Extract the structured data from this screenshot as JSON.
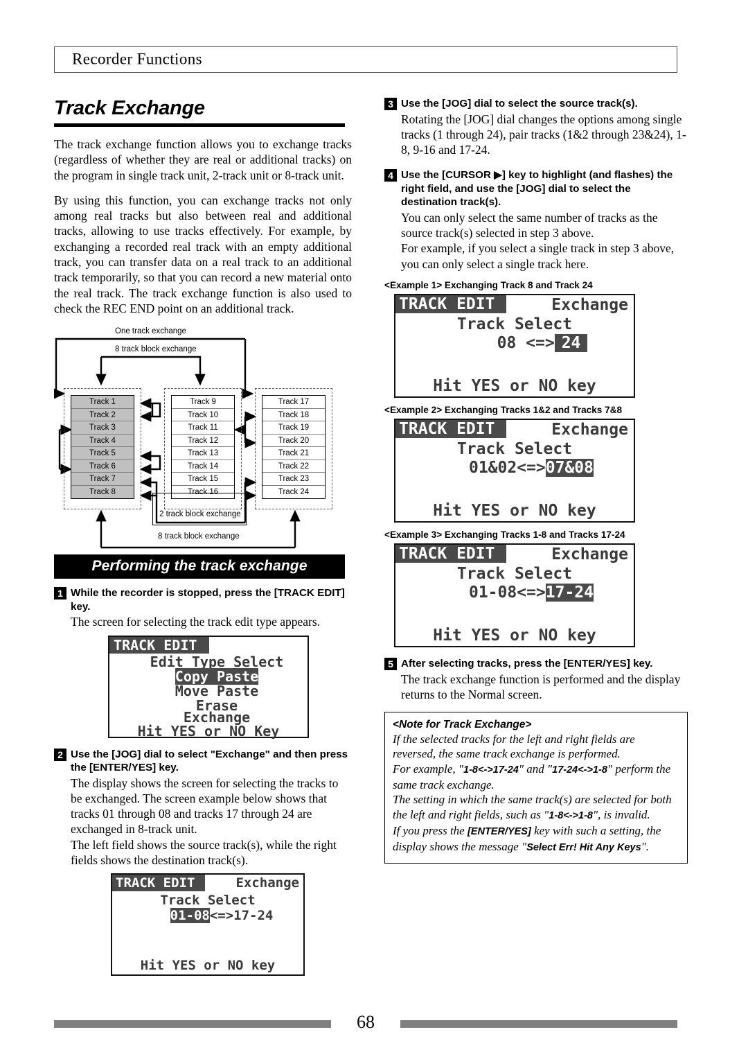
{
  "header": {
    "title": "Recorder Functions"
  },
  "footer": {
    "page_number": "68"
  },
  "left": {
    "section_title": "Track Exchange",
    "paragraphs": [
      "The track exchange function allows you to exchange tracks (regardless of whether they are real or additional tracks) on the program in single track unit, 2-track unit or 8-track unit.",
      "By using this function, you can exchange tracks not only among real tracks but also between real and additional tracks, allowing to use tracks effectively. For example, by exchanging a recorded real track with an empty additional track, you can transfer data on a real track to an additional track temporarily, so that you can record a new material onto the real track. The track exchange function is also used to check the REC END point on an additional track."
    ],
    "diagram": {
      "label_one_track": "One track exchange",
      "label_8track_top": "8 track  block exchange",
      "label_2track": "2 track  block exchange",
      "label_8track_bottom": "8 track  block exchange",
      "block1": [
        "Track 1",
        "Track 2",
        "Track 3",
        "Track 4",
        "Track 5",
        "Track 6",
        "Track 7",
        "Track 8"
      ],
      "block2": [
        "Track 9",
        "Track 10",
        "Track 11",
        "Track 12",
        "Track 13",
        "Track 14",
        "Track 15",
        "Track 16"
      ],
      "block3": [
        "Track 17",
        "Track 18",
        "Track 19",
        "Track 20",
        "Track 21",
        "Track 22",
        "Track 23",
        "Track 24"
      ]
    },
    "bar_heading": "Performing the track exchange",
    "step1": {
      "number": "1",
      "head": "While the recorder is stopped, press the [TRACK EDIT] key.",
      "body": "The screen for selecting the track edit type appears."
    },
    "lcd1": {
      "tab": "TRACK EDIT",
      "line1": "Edit Type Select",
      "item1": "Copy Paste",
      "item2": "Move Paste",
      "item3": "Erase",
      "item4": "Exchange",
      "footer": "Hit YES or NO Key"
    },
    "step2": {
      "number": "2",
      "head": "Use the [JOG] dial to select \"Exchange\" and then press the [ENTER/YES] key.",
      "body1": "The display shows the screen for selecting the tracks to be exchanged. The screen example below shows that tracks 01 through 08 and tracks 17 through 24 are exchanged in 8-track unit.",
      "body2": "The left field shows the source track(s), while the right fields shows the destination track(s)."
    },
    "lcd2": {
      "tab": "TRACK EDIT",
      "title_right": "Exchange",
      "line2": "Track Select",
      "sel_left": "01-08",
      "sel_mid": "<=>",
      "sel_right": "17-24",
      "footer": "Hit YES or NO key"
    }
  },
  "right": {
    "step3": {
      "number": "3",
      "head": "Use the [JOG] dial to select the source track(s).",
      "body": "Rotating the [JOG] dial changes the options among single tracks (1 through 24), pair tracks (1&2 through 23&24), 1-8, 9-16 and 17-24."
    },
    "step4": {
      "number": "4",
      "head": "Use the [CURSOR ▶] key to highlight (and flashes) the right field, and use the [JOG] dial to select the destination track(s).",
      "body1": "You can only select the same number of tracks as the source track(s) selected in step 3 above.",
      "body2": "For example, if you select a single track in step 3 above, you can only select a single track here."
    },
    "example1": {
      "caption": "<Example 1> Exchanging Track 8 and Track 24",
      "tab": "TRACK EDIT",
      "title_right": "Exchange",
      "line2": "Track Select",
      "sel_left": "08",
      "sel_mid": "<=>",
      "sel_right": "24",
      "footer": "Hit YES or NO key"
    },
    "example2": {
      "caption": "<Example 2> Exchanging Tracks 1&2 and Tracks 7&8",
      "tab": "TRACK EDIT",
      "title_right": "Exchange",
      "line2": "Track Select",
      "sel_left": "01&02",
      "sel_mid": "<=>",
      "sel_right": "07&08",
      "footer": "Hit YES or NO key"
    },
    "example3": {
      "caption": "<Example 3> Exchanging Tracks 1-8 and Tracks 17-24",
      "tab": "TRACK EDIT",
      "title_right": "Exchange",
      "line2": "Track Select",
      "sel_left": "01-08",
      "sel_mid": "<=>",
      "sel_right": "17-24",
      "footer": "Hit YES or NO key"
    },
    "step5": {
      "number": "5",
      "head": "After selecting tracks, press the [ENTER/YES] key.",
      "body": "The track exchange function is performed and the display returns to the Normal screen."
    },
    "note": {
      "title": "<Note for Track Exchange>",
      "l1": "If the selected tracks for the left and right fields are reversed, the same track exchange is performed.",
      "l2a": "For example, \"",
      "l2b": "1-8<->17-24",
      "l2c": "\" and \"",
      "l2d": "17-24<->1-8",
      "l2e": "\" perform the same track exchange.",
      "l3a": "The setting in which the same track(s) are selected for both the left and right fields, such as \"",
      "l3b": "1-8<->1-8",
      "l3c": "\", is invalid.",
      "l4a": "If you press the ",
      "l4b": "[ENTER/YES]",
      "l4c": " key with such a setting, the display shows the message \"",
      "l4d": "Select Err! Hit Any Keys",
      "l4e": "\"."
    }
  }
}
